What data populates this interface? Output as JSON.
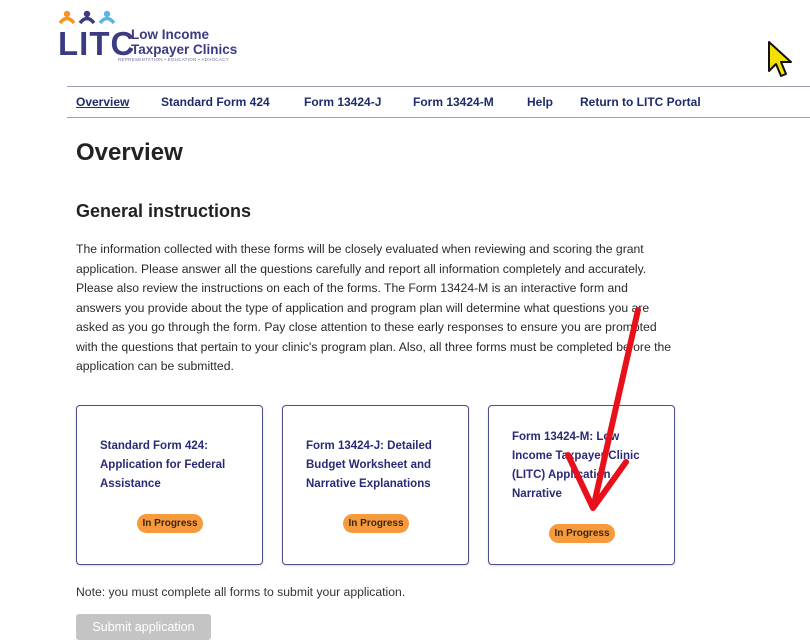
{
  "logo": {
    "abbr": "LITC",
    "name_line1": "Low Income",
    "name_line2": "Taxpayer Clinics",
    "tagline": "REPRESENTATION • EDUCATION • ADVOCACY"
  },
  "nav": {
    "items": [
      {
        "label": "Overview",
        "active": true
      },
      {
        "label": "Standard Form 424"
      },
      {
        "label": "Form 13424-J"
      },
      {
        "label": "Form 13424-M"
      },
      {
        "label": "Help"
      },
      {
        "label": "Return to LITC Portal"
      }
    ]
  },
  "page": {
    "title": "Overview",
    "section_title": "General instructions",
    "instructions": "The information collected with these forms will be closely evaluated when reviewing and scoring the grant application. Please answer all the questions carefully and report all information completely and accurately. Please also review the instructions on each of the forms. The Form 13424-M is an interactive form and answers you provide about the type of application and program plan will determine what questions you are asked as you go through the form. Pay close attention to these early responses to ensure you are prompted with the questions that pertain to your clinic's program plan. Also, all three forms must be completed before the application can be submitted."
  },
  "cards": [
    {
      "title": "Standard Form 424: Application for Federal Assistance",
      "status": "In Progress"
    },
    {
      "title": "Form 13424-J: Detailed Budget Worksheet and Narrative Explanations",
      "status": "In Progress"
    },
    {
      "title": "Form 13424-M: Low Income Taxpayer Clinic (LITC) Application Narrative",
      "status": "In Progress"
    }
  ],
  "footer": {
    "note": "Note: you must complete all forms to submit your application.",
    "submit_label": "Submit application"
  },
  "colors": {
    "brand": "#3b3b82",
    "nav_text": "#1f2b6b",
    "badge": "#f79a3e",
    "arrow": "#e8101a",
    "disabled_button": "#c4c4c4"
  },
  "icons": {
    "cursor": "mouse-pointer-icon",
    "annotation": "red-arrow-annotation"
  }
}
